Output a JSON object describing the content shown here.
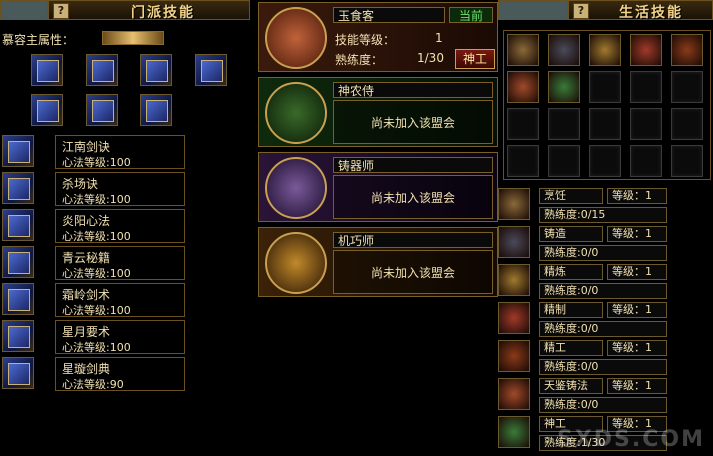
{
  "left_panel": {
    "title": "门派技能",
    "help": "?",
    "attribute_label": "慕容主属性：",
    "attribute_value": "",
    "skill_book_icons": [
      "book-icon",
      "book-icon",
      "book-icon",
      "book-icon",
      "book-icon",
      "book-icon",
      "book-icon",
      "book-icon"
    ],
    "skills": [
      {
        "name": "江南剑诀",
        "level": "心法等级:100"
      },
      {
        "name": "杀场诀",
        "level": "心法等级:100"
      },
      {
        "name": "炎阳心法",
        "level": "心法等级:100"
      },
      {
        "name": "青云秘籍",
        "level": "心法等级:100"
      },
      {
        "name": "霜岭剑术",
        "level": "心法等级:100"
      },
      {
        "name": "星月要术",
        "level": "心法等级:100"
      },
      {
        "name": "星璇剑典",
        "level": "心法等级:90"
      }
    ]
  },
  "guilds": [
    {
      "name": "玉食客",
      "current": "当前",
      "skill_level_label": "技能等级：",
      "skill_level": "1",
      "proficiency_label": "熟练度：",
      "proficiency": "1/30",
      "button": "神工",
      "color": "#c0623a"
    },
    {
      "name": "神农侍",
      "status": "尚未加入该盟会",
      "color": "#3a6a2a"
    },
    {
      "name": "铸器师",
      "status": "尚未加入该盟会",
      "color": "#5a3a7a"
    },
    {
      "name": "机巧师",
      "status": "尚未加入该盟会",
      "color": "#8a5a1a"
    }
  ],
  "right_panel": {
    "title": "生活技能",
    "help": "?",
    "life_skills": [
      {
        "name": "烹饪",
        "level": "等级：1",
        "proficiency": "熟练度:0/15"
      },
      {
        "name": "铸造",
        "level": "等级：1",
        "proficiency": "熟练度:0/0"
      },
      {
        "name": "精炼",
        "level": "等级：1",
        "proficiency": "熟练度:0/0"
      },
      {
        "name": "精制",
        "level": "等级：1",
        "proficiency": "熟练度:0/0"
      },
      {
        "name": "精工",
        "level": "等级：1",
        "proficiency": "熟练度:0/0"
      },
      {
        "name": "天鉴铸法",
        "level": "等级：1",
        "proficiency": "熟练度:0/0"
      },
      {
        "name": "神工",
        "level": "等级：1",
        "proficiency": "熟练度:1/30"
      }
    ]
  },
  "watermark": "SXDS.COM"
}
